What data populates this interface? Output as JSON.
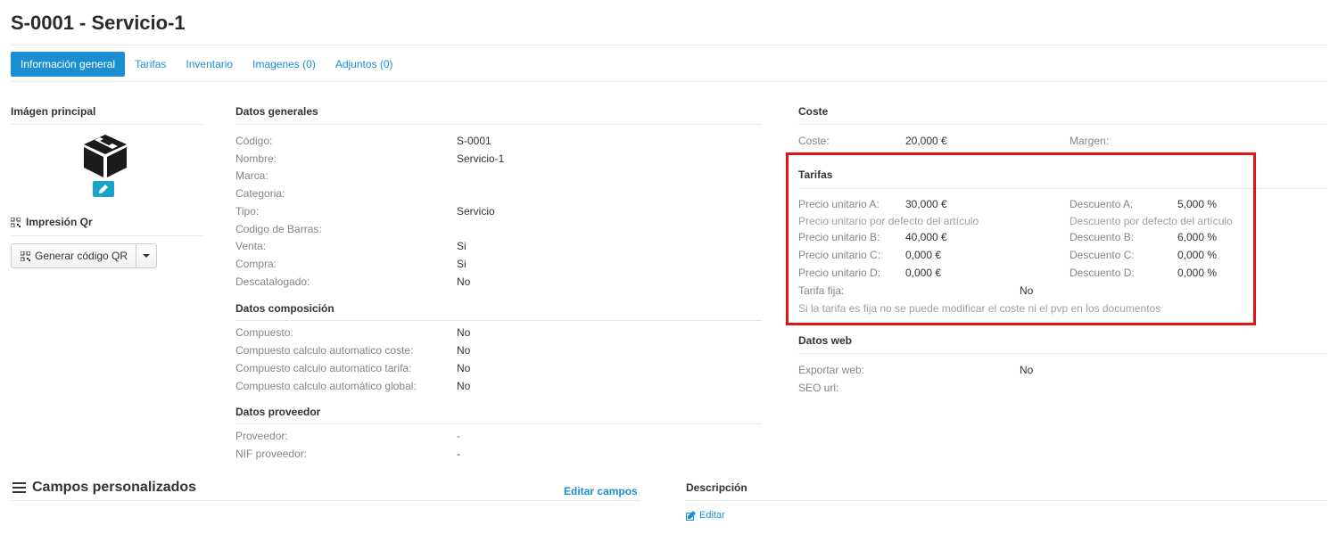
{
  "page": {
    "title": "S-0001 - Servicio-1"
  },
  "tabs": [
    {
      "label": "Información general",
      "active": true
    },
    {
      "label": "Tarifas",
      "active": false
    },
    {
      "label": "Inventario",
      "active": false
    },
    {
      "label": "Imagenes (0)",
      "active": false
    },
    {
      "label": "Adjuntos (0)",
      "active": false
    }
  ],
  "image_section": {
    "title": "Imágen principal"
  },
  "qr": {
    "title": "Impresión Qr",
    "button_label": "Generar código QR"
  },
  "datos_generales": {
    "title": "Datos generales",
    "rows": [
      {
        "label": "Código:",
        "value": "S-0001"
      },
      {
        "label": "Nombre:",
        "value": "Servicio-1"
      },
      {
        "label": "Marca:",
        "value": ""
      },
      {
        "label": "Categoria:",
        "value": ""
      },
      {
        "label": "Tipo:",
        "value": "Servicio"
      },
      {
        "label": "Codigo de Barras:",
        "value": ""
      },
      {
        "label": "Venta:",
        "value": "Si"
      },
      {
        "label": "Compra:",
        "value": "Si"
      },
      {
        "label": "Descatalogado:",
        "value": "No"
      }
    ]
  },
  "datos_composicion": {
    "title": "Datos composición",
    "rows": [
      {
        "label": "Compuesto:",
        "value": "No"
      },
      {
        "label": "Compuesto calculo automatico coste:",
        "value": "No"
      },
      {
        "label": "Compuesto calculo automatico tarifa:",
        "value": "No"
      },
      {
        "label": "Compuesto calculo automático global:",
        "value": "No"
      }
    ]
  },
  "datos_proveedor": {
    "title": "Datos proveedor",
    "rows": [
      {
        "label": "Proveedor:",
        "value": "-"
      },
      {
        "label": "NIF proveedor:",
        "value": "-"
      }
    ]
  },
  "coste": {
    "title": "Coste",
    "coste_label": "Coste:",
    "coste_value": "20,000 €",
    "margen_label": "Margen:"
  },
  "tarifas": {
    "title": "Tarifas",
    "precio_a_label": "Precio unitario A:",
    "precio_a_value": "30,000 €",
    "precio_hint": "Precio unitario por defecto del artículo",
    "precio_b_label": "Precio unitario B:",
    "precio_b_value": "40,000 €",
    "precio_c_label": "Precio unitario C:",
    "precio_c_value": "0,000 €",
    "precio_d_label": "Precio unitario D:",
    "precio_d_value": "0,000 €",
    "desc_a_label": "Descuento A:",
    "desc_a_value": "5,000 %",
    "desc_hint": "Descuento por defecto del artículo",
    "desc_b_label": "Descuento B:",
    "desc_b_value": "6,000 %",
    "desc_c_label": "Descuento C:",
    "desc_c_value": "0,000 %",
    "desc_d_label": "Descuento D:",
    "desc_d_value": "0,000 %",
    "fija_label": "Tarifa fija:",
    "fija_value": "No",
    "fija_hint": "Si la tarifa es fija no se puede modificar el coste ni el pvp en los documentos"
  },
  "datos_web": {
    "title": "Datos web",
    "exportar_label": "Exportar web:",
    "exportar_value": "No",
    "seo_label": "SEO url:"
  },
  "campos": {
    "title": "Campos personalizados",
    "edit_link": "Editar campos"
  },
  "descripcion": {
    "title": "Descripción",
    "edit_link": "Editar"
  },
  "colors": {
    "accent": "#1a8fd1",
    "highlight": "#e31414",
    "edit_badge": "#1aa3c8"
  }
}
